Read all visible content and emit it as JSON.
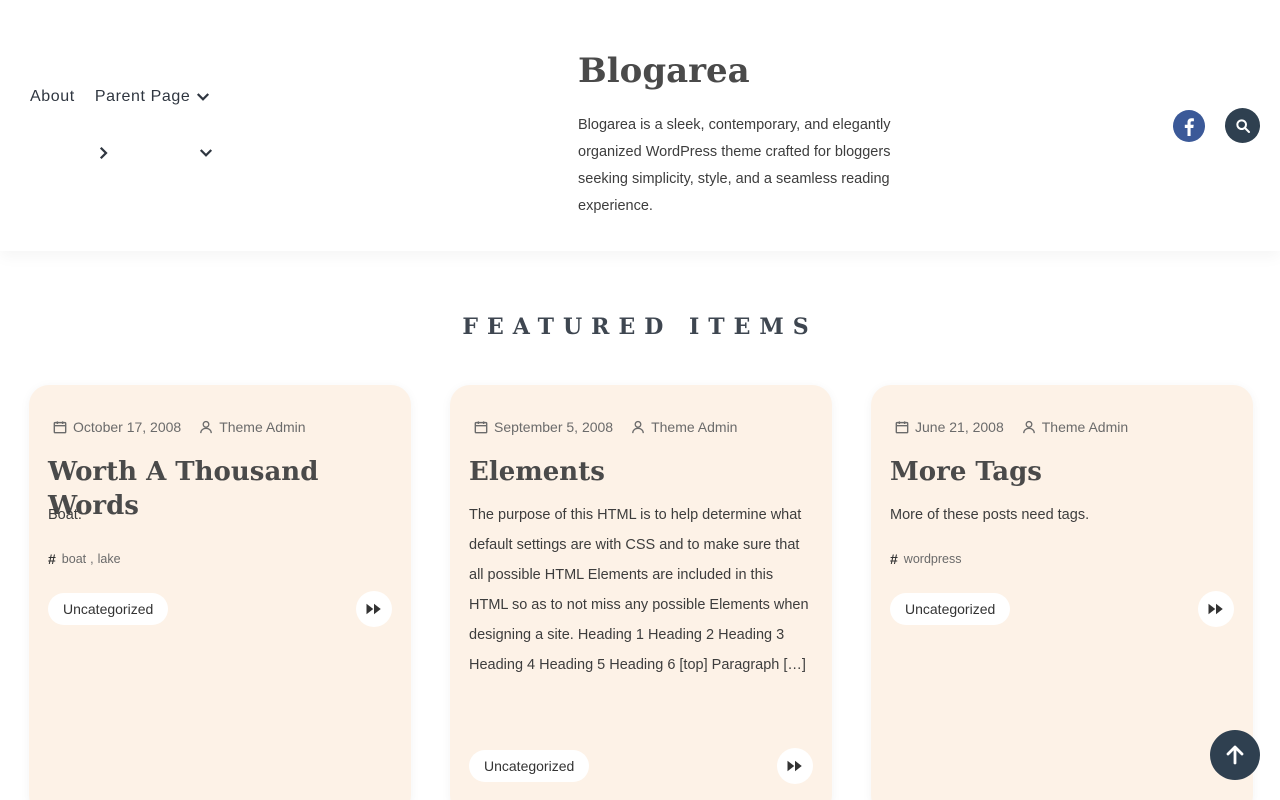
{
  "header": {
    "nav": [
      {
        "label": "About"
      },
      {
        "label": "Parent Page"
      }
    ],
    "brand_title": "Blogarea",
    "brand_description": "Blogarea is a sleek, contemporary, and elegantly organized WordPress theme crafted for bloggers seeking simplicity, style, and a seamless reading experience.",
    "icons": [
      "chevron-down-icon",
      "chevron-right-icon",
      "facebook-icon",
      "search-icon"
    ]
  },
  "featured": {
    "title": "FEATURED ITEMS",
    "cards": [
      {
        "date": "October 17, 2008",
        "author": "Theme Admin",
        "title": "Worth A Thousand Words",
        "excerpt": "Boat.",
        "tags": [
          "boat",
          "lake"
        ],
        "category": "Uncategorized"
      },
      {
        "date": "September 5, 2008",
        "author": "Theme Admin",
        "title": "Elements",
        "excerpt": "The purpose of this HTML is to help determine what default settings are with CSS and to make sure that all possible HTML Elements are included in this HTML so as to not miss any possible Elements when designing a site. Heading 1 Heading 2 Heading 3 Heading 4 Heading 5 Heading 6 [top] Paragraph […]",
        "tags": [],
        "category": "Uncategorized"
      },
      {
        "date": "June 21, 2008",
        "author": "Theme Admin",
        "title": "More Tags",
        "excerpt": "More of these posts need tags.",
        "tags": [
          "wordpress"
        ],
        "category": "Uncategorized"
      }
    ]
  },
  "colors": {
    "card_bg": "#fdf2e7",
    "dark_accent": "#2f4050",
    "facebook": "#3b5998"
  }
}
